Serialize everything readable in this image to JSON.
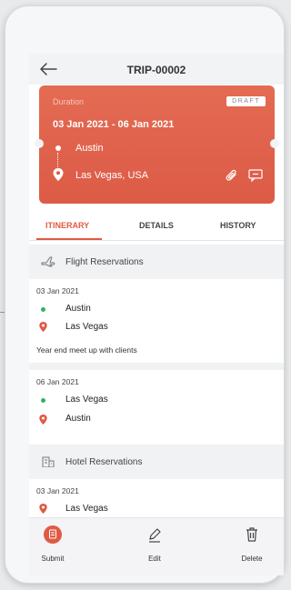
{
  "header": {
    "title": "TRIP-00002",
    "back_icon": "arrow-left-icon"
  },
  "trip_card": {
    "duration_label": "Duration",
    "duration_value": "03 Jan 2021 - 06 Jan 2021",
    "status_badge": "DRAFT",
    "origin": "Austin",
    "destination": "Las Vegas, USA",
    "accent_color": "#e05a43"
  },
  "tabs": [
    {
      "label": "ITINERARY",
      "active": true
    },
    {
      "label": "DETAILS",
      "active": false
    },
    {
      "label": "HISTORY",
      "active": false
    }
  ],
  "flight_section": {
    "title": "Flight Reservations",
    "icon": "airplane-icon",
    "reservations": [
      {
        "date": "03 Jan 2021",
        "from": "Austin",
        "to": "Las Vegas",
        "note": "Year end meet up with clients"
      },
      {
        "date": "06 Jan 2021",
        "from": "Las Vegas",
        "to": "Austin"
      }
    ]
  },
  "hotel_section": {
    "title": "Hotel Reservations",
    "icon": "building-icon",
    "reservations": [
      {
        "date": "03 Jan 2021",
        "location": "Las Vegas"
      }
    ]
  },
  "actions": {
    "submit": "Submit",
    "edit": "Edit",
    "delete": "Delete"
  }
}
